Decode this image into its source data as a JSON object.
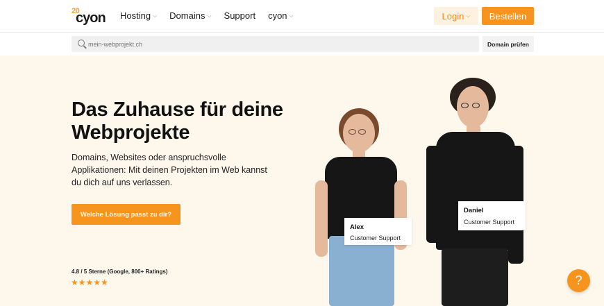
{
  "header": {
    "logo_anniversary": "20",
    "logo_text": "cyon",
    "nav": [
      {
        "label": "Hosting",
        "has_dropdown": true
      },
      {
        "label": "Domains",
        "has_dropdown": true
      },
      {
        "label": "Support",
        "has_dropdown": false
      },
      {
        "label": "cyon",
        "has_dropdown": true
      }
    ],
    "login_label": "Login",
    "order_label": "Bestellen"
  },
  "domain_search": {
    "placeholder": "mein-webprojekt.ch",
    "button_label": "Domain prüfen"
  },
  "hero": {
    "headline": "Das Zuhause für deine Webprojekte",
    "lead": "Domains, Websites oder anspruchsvolle Applikationen: Mit deinen Projekten im Web kannst du dich auf uns verlassen.",
    "cta_label": "Welche Lösung passt zu dir?",
    "rating_text": "4.8 / 5 Sterne (Google, 800+ Ratings)",
    "stars": "★★★★★",
    "rating_stars_count": 5
  },
  "team": [
    {
      "name": "Alex",
      "role": "Customer Support"
    },
    {
      "name": "Daniel",
      "role": "Customer Support"
    }
  ],
  "help_button_label": "?",
  "colors": {
    "accent": "#f7941d",
    "hero_bg": "#fdf7ec",
    "login_bg": "#fdf1df"
  }
}
